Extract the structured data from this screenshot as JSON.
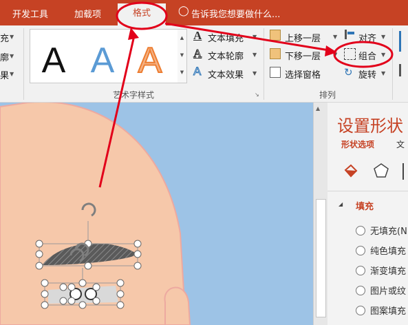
{
  "tabs": {
    "developer": "开发工具",
    "addins": "加载项",
    "format": "格式",
    "tell_me": "告诉我您想要做什么..."
  },
  "left_cut": {
    "fill_frag": "充",
    "outline_frag": "廓",
    "effect_frag": "果"
  },
  "wordart": {
    "sample": "A",
    "fill": "文本填充",
    "outline": "文本轮廓",
    "effect": "文本效果",
    "group_title": "艺术字样式"
  },
  "arrange": {
    "bring_forward": "上移一层",
    "send_backward": "下移一层",
    "selection_pane": "选择窗格",
    "align": "对齐",
    "group": "组合",
    "rotate": "旋转",
    "group_title": "排列"
  },
  "pane": {
    "title": "设置形状",
    "tab_shape": "形状选项",
    "tab_text": "文",
    "section_fill": "填充",
    "options": [
      "无填充(N",
      "纯色填充",
      "渐变填充",
      "图片或纹",
      "图案填充"
    ]
  },
  "colors": {
    "accent": "#c64224",
    "annotation": "#e2001a",
    "canvas": "#9dc3e6",
    "skin": "#f6c8aa"
  }
}
